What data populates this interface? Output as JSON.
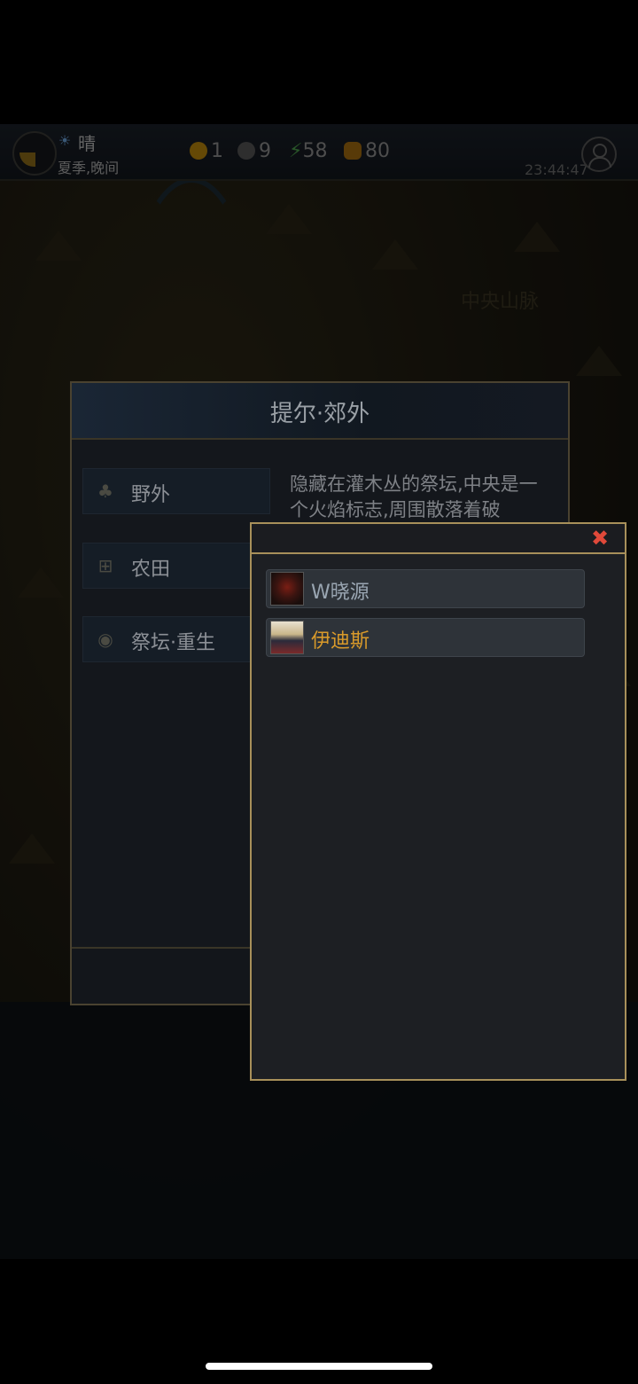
{
  "status": {
    "weather": "晴",
    "season": "夏季,晚间",
    "clock": "23:44:47"
  },
  "resources": {
    "gold": "1",
    "silver": "9",
    "energy": "58",
    "food": "80"
  },
  "map": {
    "region_label": "中央山脉"
  },
  "location": {
    "title": "提尔·郊外",
    "items": [
      {
        "label": "野外",
        "icon": "tree-icon"
      },
      {
        "label": "农田",
        "icon": "field-icon"
      },
      {
        "label": "祭坛·重生",
        "icon": "altar-icon"
      }
    ],
    "description": "隐藏在灌木丛的祭坛,中央是一个火焰标志,周围散落着破"
  },
  "popup": {
    "close_label": "✖",
    "players": [
      {
        "name": "W晓源",
        "color": "#9aa6b2"
      },
      {
        "name": "伊迪斯",
        "color": "#d99a2a"
      }
    ]
  },
  "colors": {
    "accent_border": "#a8905a",
    "close": "#e0493a"
  }
}
